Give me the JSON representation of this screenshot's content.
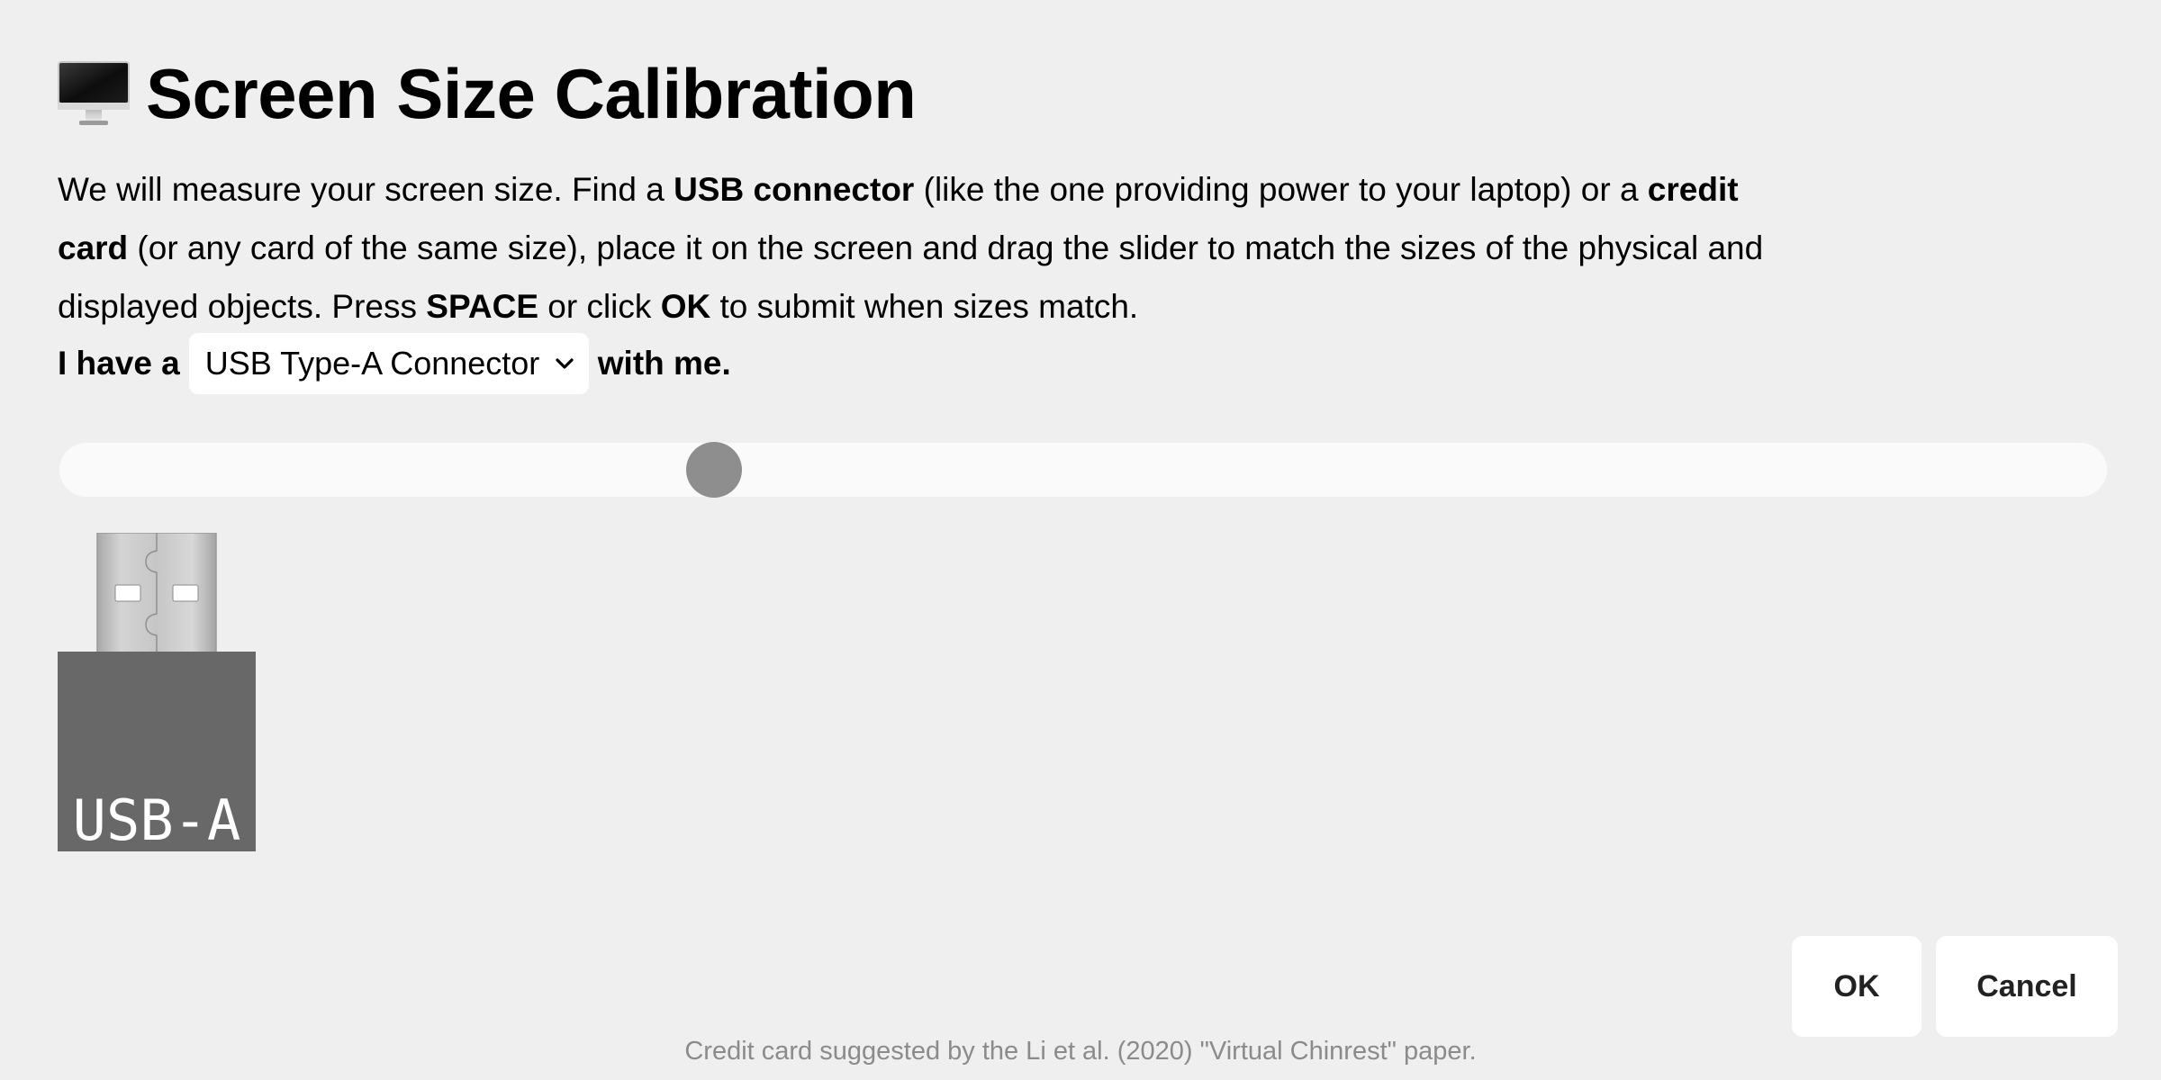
{
  "title": {
    "icon": "desktop-computer-icon",
    "text": "Screen Size Calibration"
  },
  "intro": {
    "p1": "We will measure your screen size. Find a ",
    "b1": "USB connector",
    "p2": " (like the one providing power to your laptop) or a ",
    "b2": "credit card",
    "p3": " (or any card of the same size), place it on the screen and drag the slider to match the sizes of the physical and displayed objects. Press ",
    "b3": "SPACE",
    "p4": " or click ",
    "b4": "OK",
    "p5": " to submit when sizes match."
  },
  "device_row": {
    "prefix": "I have a",
    "selected": "USB Type-A Connector",
    "suffix": "with me."
  },
  "slider": {
    "value_fraction": 0.315
  },
  "usb_image": {
    "label": "USB-A",
    "body_color": "#686868",
    "plug_color": "#c9c9c9"
  },
  "buttons": {
    "ok": "OK",
    "cancel": "Cancel"
  },
  "footnote": "Credit card suggested by the Li et al. (2020) \"Virtual Chinrest\" paper."
}
